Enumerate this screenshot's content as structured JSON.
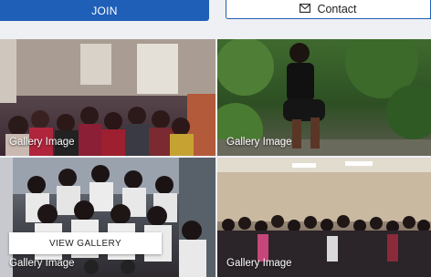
{
  "header": {
    "join_label": "JOIN",
    "contact_label": "Contact"
  },
  "gallery": {
    "tiles": [
      {
        "caption": "Gallery Image"
      },
      {
        "caption": "Gallery Image"
      },
      {
        "caption": "Gallery Image"
      },
      {
        "caption": "Gallery Image"
      }
    ],
    "view_button_label": "VIEW GALLERY"
  },
  "colors": {
    "brand_blue": "#1f5fb8",
    "background": "#eef0f3"
  },
  "icons": {
    "contact": "envelope-icon"
  }
}
